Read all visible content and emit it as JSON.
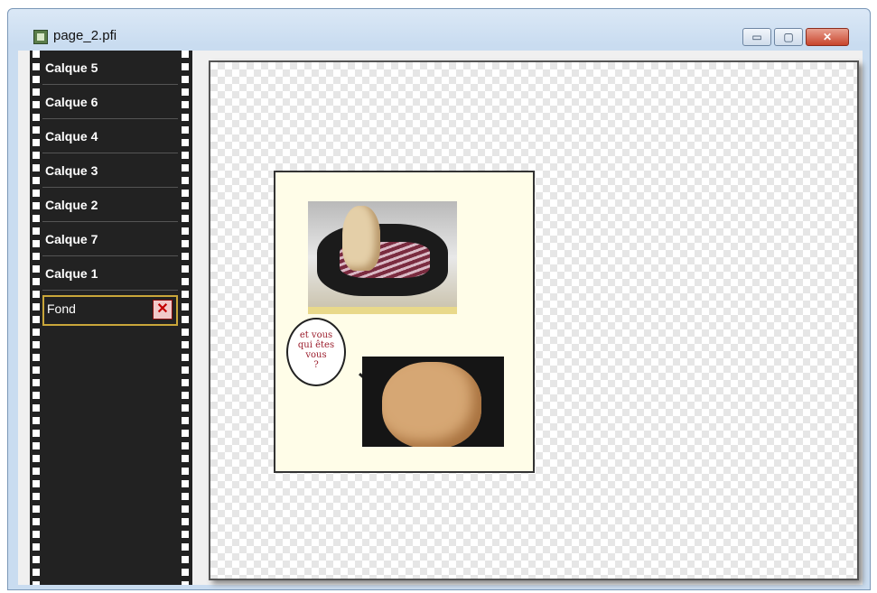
{
  "window": {
    "title": "page_2.pfi"
  },
  "controls": {
    "minimize": "▭",
    "maximize": "▢",
    "close": "✕"
  },
  "layers": [
    {
      "label": "Calque 5"
    },
    {
      "label": "Calque 6"
    },
    {
      "label": "Calque 4"
    },
    {
      "label": "Calque 3"
    },
    {
      "label": "Calque 2"
    },
    {
      "label": "Calque 7"
    },
    {
      "label": "Calque 1"
    },
    {
      "label": "Fond",
      "selected": true
    }
  ],
  "canvas": {
    "speech_bubble": [
      "et vous",
      "qui êtes",
      "vous",
      "?"
    ]
  },
  "colors": {
    "selection_border": "#c9a63a",
    "filmstrip": "#222222",
    "delete_icon": "#c20000"
  }
}
